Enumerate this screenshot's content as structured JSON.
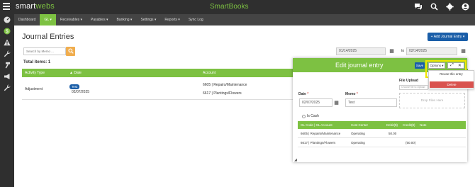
{
  "app": {
    "logo": "smartwebs",
    "title": "SmartBooks"
  },
  "nav": {
    "items": [
      {
        "label": "Dashboard"
      },
      {
        "label": "GL ▾"
      },
      {
        "label": "Receivables ▾"
      },
      {
        "label": "Payables ▾"
      },
      {
        "label": "Banking ▾"
      },
      {
        "label": "Settings ▾"
      },
      {
        "label": "Reports ▾"
      },
      {
        "label": "Sync Log"
      }
    ]
  },
  "page": {
    "title": "Journal Entries",
    "add_button": "+ Add Journal Entry ▾",
    "search_placeholder": "Search by Memo ...",
    "date_from": "01/14/2025",
    "date_to": "02/14/2025",
    "to_label": "to",
    "total_items": "Total items: 1"
  },
  "table": {
    "headers": {
      "activity_type": "Activity Type",
      "date": "▲ Date",
      "account": "Account"
    },
    "rows": [
      {
        "activity_type": "Adjustment",
        "badge": "Test",
        "date": "02/07/2025",
        "account_1": "6605 | Repairs/Maintenance",
        "account_2": "6617 | Plantings/Flowers"
      }
    ]
  },
  "modal": {
    "title": "Edit journal entry",
    "save": "Save",
    "options": "Options ▾",
    "expand_glyph": "⤢",
    "close_glyph": "✕",
    "dropdown": {
      "reuse": "Reuse this entry",
      "delete": "Delete"
    },
    "date_label": "Date",
    "date_value": "02/07/2025",
    "memo_label": "Memo",
    "memo_value": "Test",
    "file_upload_label": "File Upload",
    "file_placeholder": "Choose file to Upload",
    "drop_text": "Drop Files Here",
    "is_cash_label": "Is Cash",
    "lines_headers": {
      "account": "GL Code | GL Account",
      "cost_center": "Cost Center",
      "debit": "Debit($)",
      "credit": "Credit($)",
      "note": "Note"
    },
    "lines": [
      {
        "account": "6605 | Repairs/Maintenance",
        "cost_center": "Operating",
        "debit": "50.00",
        "credit": ""
      },
      {
        "account": "6617 | Plantings/Flowers",
        "cost_center": "Operating",
        "debit": "",
        "credit": "(50.00)"
      }
    ]
  },
  "colors": {
    "accent_green": "#7dc142",
    "primary_blue": "#1a5ea8",
    "danger_red": "#d9534f",
    "highlight_yellow": "#f2e600",
    "dark_bar": "#2f2f2f"
  }
}
